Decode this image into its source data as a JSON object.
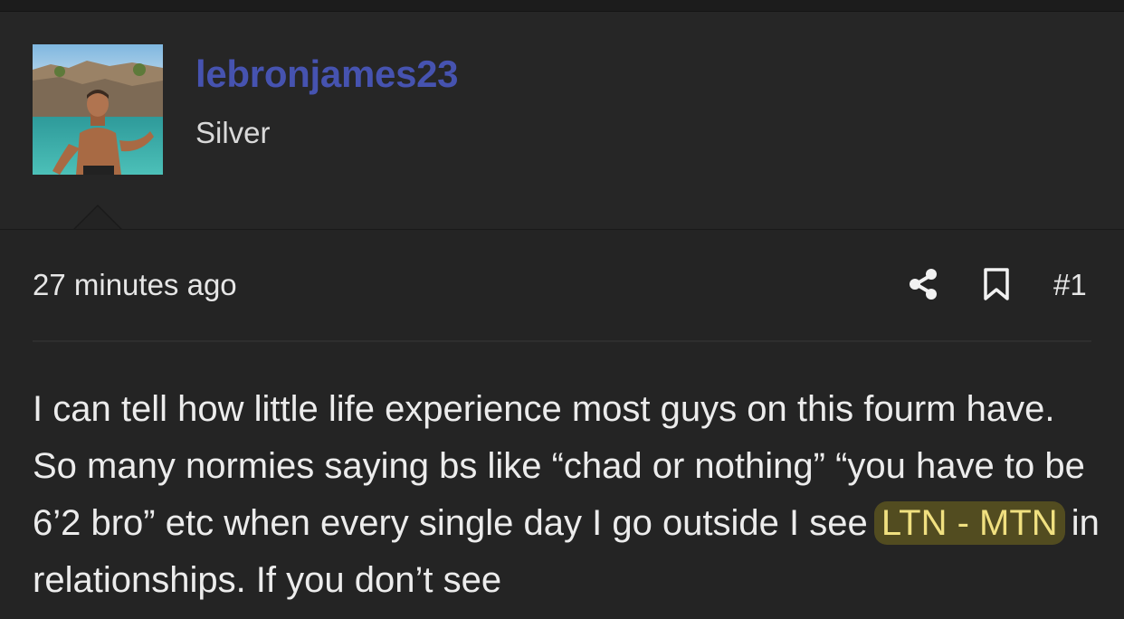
{
  "user": {
    "name": "lebronjames23",
    "title": "Silver"
  },
  "post": {
    "time": "27 minutes ago",
    "number": "#1",
    "share_icon": "share-icon",
    "bookmark_icon": "bookmark-icon",
    "body_before": "I can tell how little life experience most guys on this fourm have. So many normies saying bs like “chad or nothing” “you have to be 6’2 bro” etc when every single day I go outside I see ",
    "highlight": "LTN - MTN",
    "body_after": " in relationships. If you don’t see"
  },
  "colors": {
    "background": "#242424",
    "username": "#4653b0",
    "highlight": "#f0e080"
  }
}
